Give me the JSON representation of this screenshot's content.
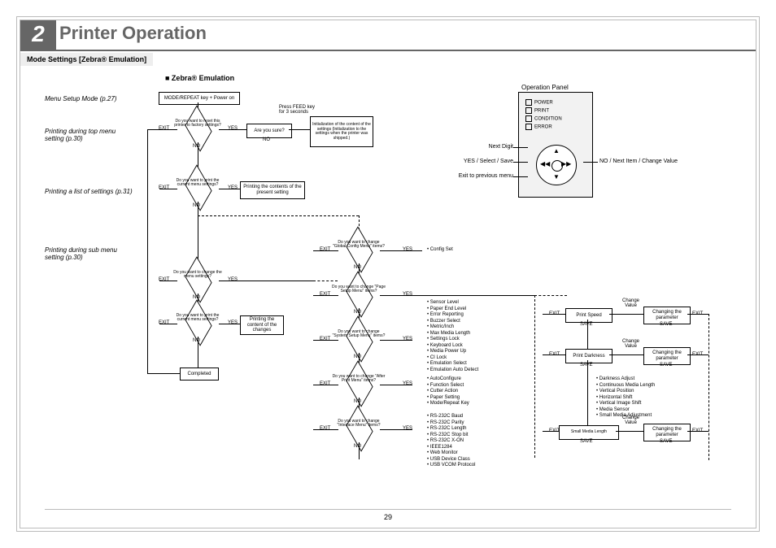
{
  "chapter": {
    "num": "2",
    "title": "Printer Operation"
  },
  "mode_strip": "Mode Settings [Zebra® Emulation]",
  "section_heading": "■ Zebra® Emulation",
  "page_number": "29",
  "side_notes": {
    "a": "Menu Setup Mode (p.27)",
    "b": "Printing during top menu setting (p.30)",
    "c": "Printing a list of settings (p.31)",
    "d": "Printing during sub menu setting (p.30)"
  },
  "labels": {
    "exit": "EXIT",
    "yes": "YES",
    "no": "NO",
    "save": "SAVE",
    "change_value": "Change\nValue",
    "next_digit": "Next Digit",
    "yes_select": "YES / Select / Save",
    "exit_prev": "Exit to previous menu",
    "no_next": "NO / Next Item / Change Value",
    "feed": "Press FEED key\nfor 3 seconds",
    "config_set": "Config Set",
    "op_panel": "Operation Panel"
  },
  "boxes": {
    "start": "MODE/REPEAT key + Power on",
    "areyousure": "Are you sure?",
    "init": "Initialization of the content of the settings (Initialization to the settings when the printer was shipped.)",
    "print_present": "Printing the contents of the present setting",
    "print_changes": "Printing the content of the changes",
    "completed": "Completed",
    "print_speed": "Print Speed",
    "print_darkness": "Print Darkness",
    "small_media": "Small Media Length",
    "changing": "Changing the parameter"
  },
  "diamonds": {
    "reset": "Do you want to reset this printer to factory settings?",
    "print_current": "Do you want to print the current menu settings?",
    "change_menu": "Do you want to change the menu settings?",
    "print_current2": "Do you want to print the current menu settings?",
    "global": "Do you want to change \"Global Config Menu\" items?",
    "page_setup": "Do you want to change \"Page Setup Menu\" items?",
    "system_setup": "Do you want to change \"System Setup Menu\" items?",
    "after_print": "Do you want to change \"After Print Menu\" items?",
    "interface": "Do you want to change \"Interface Menu\" items?"
  },
  "bullet_groups": {
    "page_setup": [
      "Sensor Level",
      "Paper End Level",
      "Error Reporting",
      "Buzzer Select",
      "Metric/Inch",
      "Max Media Length",
      "Settings Lock",
      "Keyboard Lock",
      "Media Power Up",
      "CI Lock",
      "Emulation Select",
      "Emulation Auto Detect"
    ],
    "after_print": [
      "AutoConfigure",
      "Function Select",
      "Cutter Action",
      "Paper Setting",
      "Mode/Repeat Key"
    ],
    "interface": [
      "RS-232C Baud",
      "RS-232C Parity",
      "RS-232C Length",
      "RS-232C Stop bit",
      "RS-232C X-ON",
      "IEEE1284",
      "Web Monitor",
      "USB Device Class",
      "USB VCOM Protocol"
    ],
    "param": [
      "Darkness Adjust",
      "Continuous Media Length",
      "Vertical Position",
      "Horizontal Shift",
      "Vertical Image Shift",
      "Media Sensor",
      "Small Media Adjustment"
    ]
  },
  "panel": {
    "leds": [
      "POWER",
      "PRINT",
      "CONDITION",
      "ERROR"
    ]
  }
}
